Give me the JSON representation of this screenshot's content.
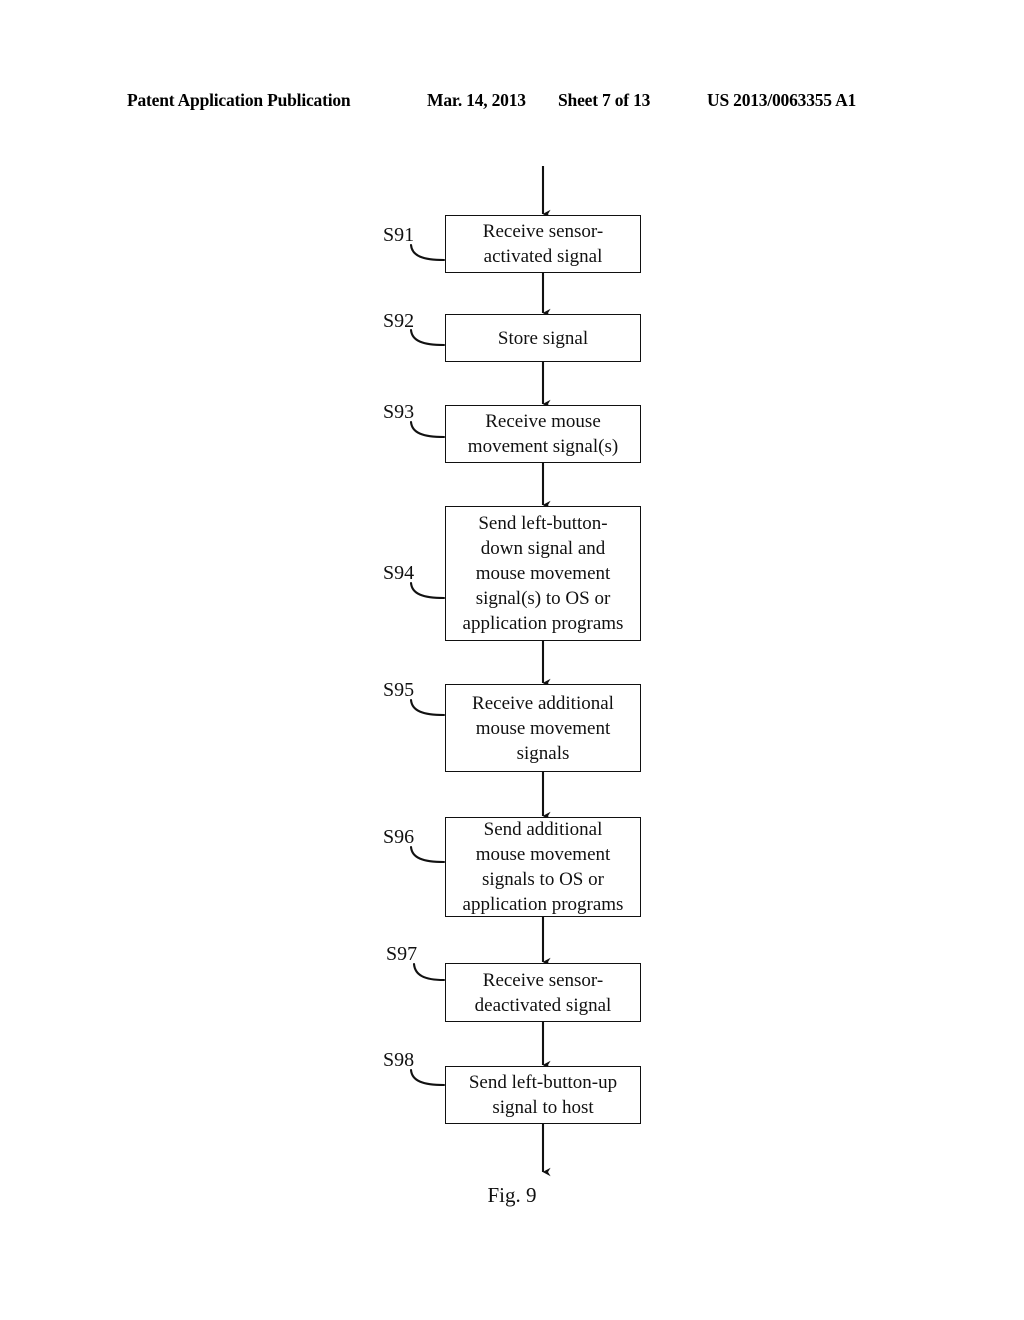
{
  "header": {
    "publication": "Patent Application Publication",
    "date": "Mar. 14, 2013",
    "sheet": "Sheet 7 of 13",
    "publication_number": "US 2013/0063355 A1"
  },
  "figure": {
    "caption": "Fig. 9",
    "type": "flowchart",
    "line_color": "#111111",
    "background_color": "#ffffff"
  },
  "flowchart": {
    "entry_arrow": true,
    "exit_arrow": true,
    "steps": [
      {
        "id": "S91",
        "label": "S91",
        "text": "Receive sensor-\nactivated signal",
        "lines": 2
      },
      {
        "id": "S92",
        "label": "S92",
        "text": "Store signal",
        "lines": 1
      },
      {
        "id": "S93",
        "label": "S93",
        "text": "Receive mouse\nmovement signal(s)",
        "lines": 2
      },
      {
        "id": "S94",
        "label": "S94",
        "text": "Send left-button-\ndown signal and\nmouse movement\nsignal(s) to OS or\napplication programs",
        "lines": 5
      },
      {
        "id": "S95",
        "label": "S95",
        "text": "Receive additional\nmouse movement\nsignals",
        "lines": 3
      },
      {
        "id": "S96",
        "label": "S96",
        "text": "Send additional\nmouse movement\nsignals to OS or\napplication programs",
        "lines": 4
      },
      {
        "id": "S97",
        "label": "S97",
        "text": "Receive sensor-\ndeactivated signal",
        "lines": 2
      },
      {
        "id": "S98",
        "label": "S98",
        "text": "Send left-button-up\nsignal to host",
        "lines": 2
      }
    ]
  }
}
